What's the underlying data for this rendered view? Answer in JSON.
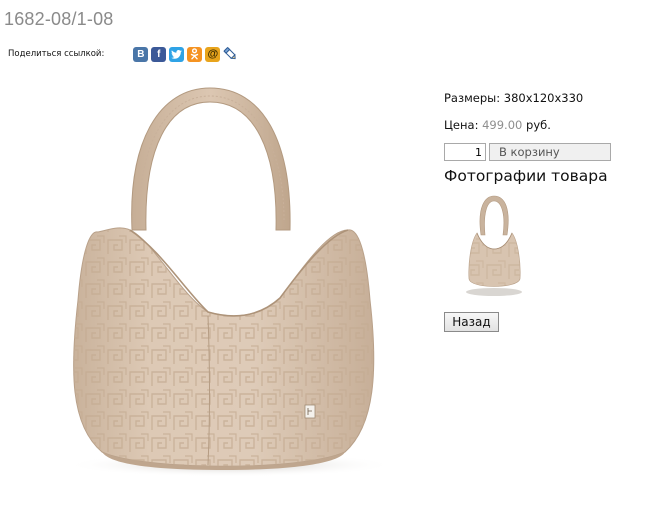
{
  "product": {
    "code": "1682-08/1-08"
  },
  "share": {
    "label": "Поделиться ссылкой:",
    "icons": [
      {
        "name": "vkontakte-icon",
        "glyph": "В",
        "color": "#4a76a8"
      },
      {
        "name": "facebook-icon",
        "glyph": "f",
        "color": "#3b5998"
      },
      {
        "name": "twitter-icon",
        "glyph": "t",
        "color": "#2fa3e6"
      },
      {
        "name": "odnoklassniki-icon",
        "glyph": "ok",
        "color": "#f59322"
      },
      {
        "name": "mail-ru-icon",
        "glyph": "@",
        "color": "#e8a41c"
      },
      {
        "name": "livejournal-icon",
        "glyph": "",
        "color": "#5a7fb0"
      }
    ]
  },
  "details": {
    "size_label": "Размеры:",
    "size_value": "380x120x330",
    "price_label": "Цена:",
    "price_value": "499.00",
    "currency": "руб.",
    "quantity": "1",
    "add_to_cart": "В корзину"
  },
  "gallery": {
    "heading": "Фотографии товара"
  },
  "nav": {
    "back": "Назад"
  },
  "colors": {
    "bag_beige": "#d8c3ae",
    "title_gray": "#8a8a8a"
  }
}
